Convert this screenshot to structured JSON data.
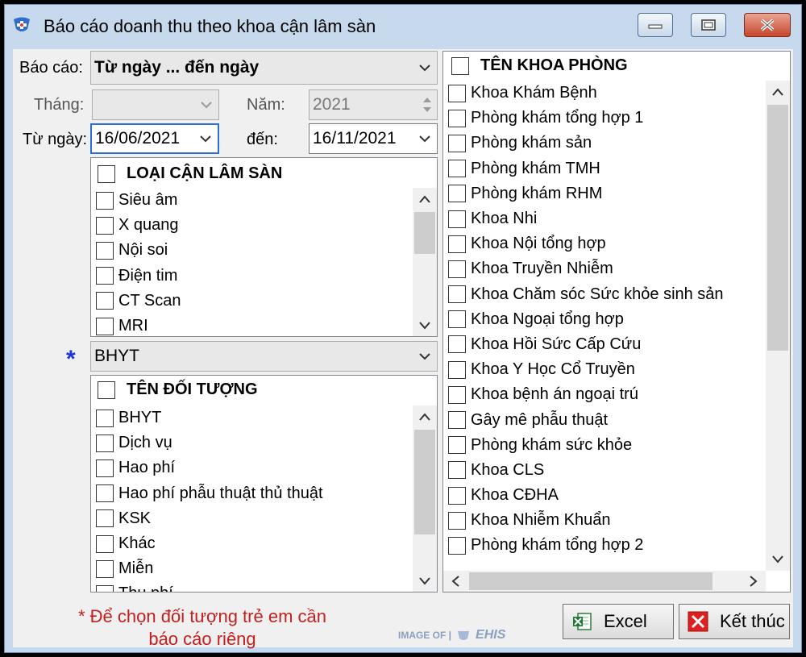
{
  "window": {
    "title": "Báo cáo doanh thu theo khoa cận lâm sàn"
  },
  "form": {
    "report_label": "Báo cáo:",
    "report_value": "Từ ngày ... đến ngày",
    "month_label": "Tháng:",
    "month_value": "",
    "year_label": "Năm:",
    "year_value": "2021",
    "from_label": "Từ ngày:",
    "from_value": "16/06/2021",
    "to_label": "đến:",
    "to_value": "16/11/2021",
    "insurance_value": "BHYT",
    "required_mark": "*"
  },
  "clinical_types": {
    "header": "LOẠI CẬN LÂM SÀN",
    "items": [
      "Siêu âm",
      "X quang",
      "Nội soi",
      "Điện tim",
      "CT Scan",
      "MRI"
    ]
  },
  "subjects": {
    "header": "TÊN ĐỐI TƯỢNG",
    "items": [
      "BHYT",
      "Dịch vụ",
      "Hao phí",
      "Hao phí phẫu thuật thủ thuật",
      "KSK",
      "Khác",
      "Miễn",
      "Thu phí"
    ]
  },
  "departments": {
    "header": "TÊN KHOA PHÒNG",
    "items": [
      "Khoa Khám Bệnh",
      "Phòng khám tổng hợp 1",
      "Phòng khám sản",
      "Phòng khám TMH",
      "Phòng khám RHM",
      "Khoa Nhi",
      "Khoa Nội tổng hợp",
      "Khoa Truyền Nhiễm",
      "Khoa Chăm sóc Sức khỏe sinh sản",
      "Khoa Ngoại tổng hợp",
      "Khoa Hồi Sức Cấp Cứu",
      "Khoa Y Học Cổ Truyền",
      "Khoa bệnh án ngoại trú",
      "Gây mê phẫu thuật",
      "Phòng khám sức khỏe",
      "Khoa CLS",
      "Khoa CĐHA",
      "Khoa Nhiễm Khuẩn",
      "Phòng khám tổng hợp 2"
    ]
  },
  "footer": {
    "note": "* Để chọn đối tượng trẻ em cần báo cáo riêng",
    "excel_label": "Excel",
    "exit_label": "Kết thúc",
    "watermark_text": "IMAGE OF |",
    "watermark_logo": "EHIS"
  },
  "colors": {
    "titlebar": "#c7d9ec",
    "note_red": "#c41e1e",
    "star_blue": "#1c35d8",
    "close_red": "#c6452c"
  },
  "icons": {
    "app": "app-logo-icon",
    "dropdown": "chevron-down-icon",
    "excel": "excel-icon",
    "exit": "close-red-icon"
  }
}
